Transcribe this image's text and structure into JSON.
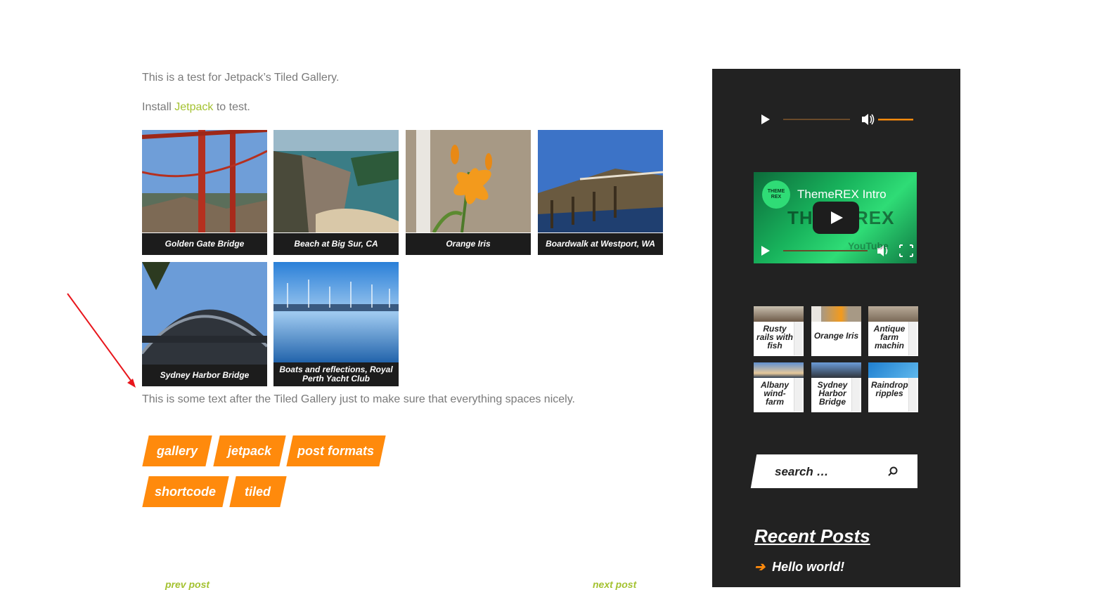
{
  "content": {
    "intro": "This is a test for Jetpack’s Tiled Gallery.",
    "install_prefix": "Install ",
    "install_link": "Jetpack",
    "install_suffix": " to test.",
    "after_text": "This is some text after the Tiled Gallery just to make sure that everything spaces nicely."
  },
  "gallery": [
    {
      "caption": "Golden Gate Bridge"
    },
    {
      "caption": "Beach at Big Sur, CA"
    },
    {
      "caption": "Orange Iris"
    },
    {
      "caption": "Boardwalk at Westport, WA"
    },
    {
      "caption": "Sydney Harbor Bridge"
    },
    {
      "caption": "Boats and reflections, Royal Perth Yacht Club"
    }
  ],
  "tags": [
    "gallery",
    "jetpack",
    "post formats",
    "shortcode",
    "tiled"
  ],
  "post_nav": {
    "prev": "prev post",
    "next": "next post"
  },
  "sidebar": {
    "video_title": "ThemeREX Intro",
    "video_logo": "THEME REX",
    "video_overlay": "THEMEREX",
    "youtube": "YouTube",
    "thumbs": [
      {
        "label": "Rusty rails with fish"
      },
      {
        "label": "Orange Iris"
      },
      {
        "label": "Antique farm machin"
      },
      {
        "label": "Albany wind-farm"
      },
      {
        "label": "Sydney Harbor Bridge"
      },
      {
        "label": "Raindrop ripples"
      }
    ],
    "search_placeholder": "search …",
    "recent_posts_title": "Recent Posts",
    "recent_posts": [
      "Hello world!"
    ]
  },
  "colors": {
    "accent": "#ff8a0c",
    "link": "#a4c231",
    "sidebar_bg": "#222222"
  }
}
